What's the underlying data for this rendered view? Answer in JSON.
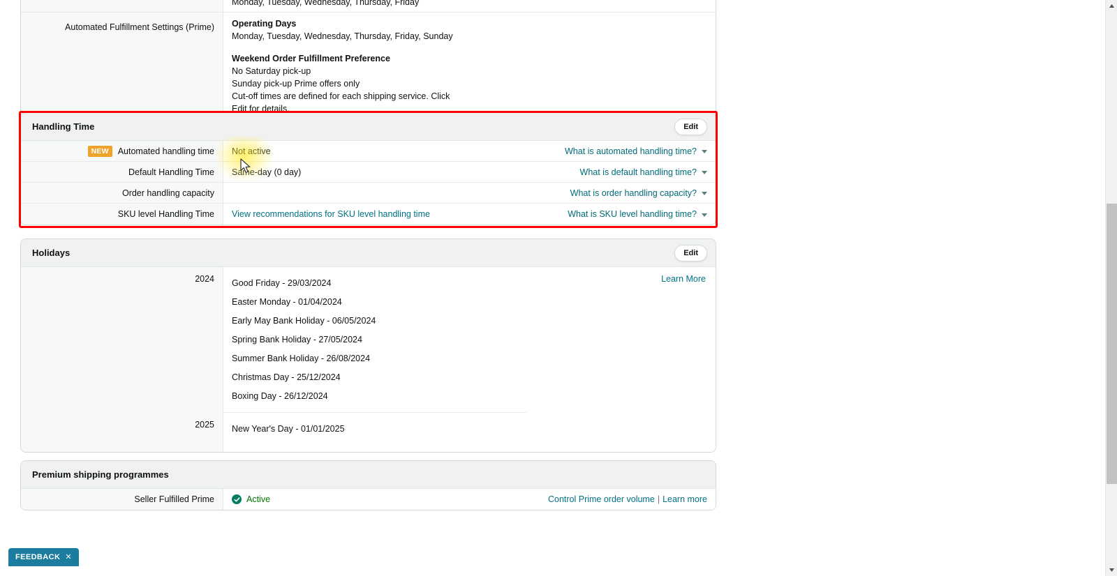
{
  "top_section": {
    "partial_row": {
      "value": "Monday, Tuesday, Wednesday, Thursday, Friday"
    },
    "automated_fulfillment": {
      "label": "Automated Fulfillment Settings (Prime)",
      "operating_days_title": "Operating Days",
      "operating_days_value": "Monday, Tuesday, Wednesday, Thursday, Friday, Sunday",
      "weekend_title": "Weekend Order Fulfillment Preference",
      "weekend_line1": "No Saturday pick-up",
      "weekend_line2": "Sunday pick-up Prime offers only",
      "note": "Cut-off times are defined for each shipping service. Click Edit for details."
    }
  },
  "handling_time": {
    "title": "Handling Time",
    "edit_label": "Edit",
    "rows": [
      {
        "badge": "NEW",
        "label": "Automated handling time",
        "value": "Not active",
        "help": "What is automated handling time?",
        "icon": "chevron-down-icon"
      },
      {
        "badge": "",
        "label": "Default Handling Time",
        "value": "Same-day (0 day)",
        "help": "What is default handling time?",
        "icon": "chevron-down-icon"
      },
      {
        "badge": "",
        "label": "Order handling capacity",
        "value": "",
        "help": "What is order handling capacity?",
        "icon": "chevron-down-icon"
      },
      {
        "badge": "",
        "label": "SKU level Handling Time",
        "value": "",
        "link": "View recommendations for SKU level handling time",
        "help": "What is SKU level handling time?",
        "icon": "chevron-down-icon"
      }
    ]
  },
  "holidays": {
    "title": "Holidays",
    "edit_label": "Edit",
    "learn_more_label": "Learn More",
    "years": [
      {
        "year": "2024",
        "items": [
          "Good Friday - 29/03/2024",
          "Easter Monday - 01/04/2024",
          "Early May Bank Holiday - 06/05/2024",
          "Spring Bank Holiday - 27/05/2024",
          "Summer Bank Holiday - 26/08/2024",
          "Christmas Day - 25/12/2024",
          "Boxing Day - 26/12/2024"
        ]
      },
      {
        "year": "2025",
        "items": [
          "New Year's Day - 01/01/2025"
        ]
      }
    ]
  },
  "premium": {
    "title": "Premium shipping programmes",
    "row_label": "Seller Fulfilled Prime",
    "status": "Active",
    "status_icon": "check-circle-icon",
    "status_color": "#007600",
    "link_control": "Control Prime order volume",
    "separator": "|",
    "link_learn_more": "Learn more"
  },
  "feedback": {
    "label": "FEEDBACK",
    "close_icon": "close-icon",
    "background": "#1b7c9e"
  },
  "scrollbar": {
    "up_icon": "scroll-up-arrow-icon",
    "down_icon": "scroll-down-arrow-icon"
  },
  "colors": {
    "link": "#007185",
    "help_link": "#006b77",
    "badge_new": "#f0a32b",
    "highlight_outline": "#ff0000",
    "panel_header": "#f0f2f2"
  }
}
